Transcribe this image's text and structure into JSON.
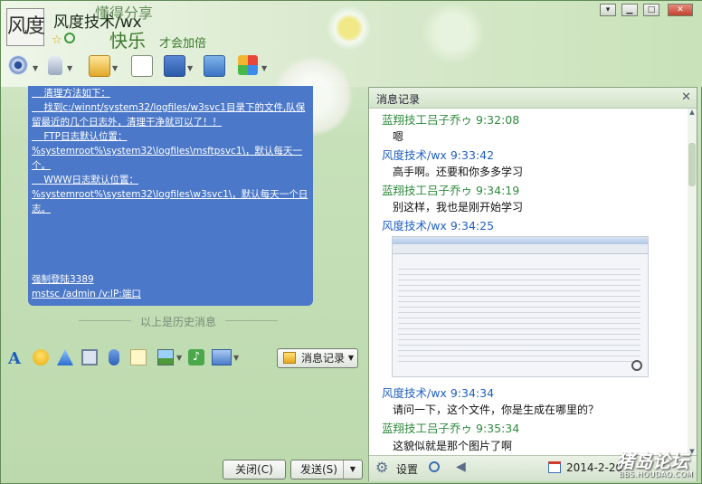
{
  "window": {
    "contact_name": "风度技术/wx",
    "avatar_text": "风度",
    "banner_text_1": "懂得分享",
    "banner_text_2": "快乐",
    "banner_text_3": "才会加倍"
  },
  "chat": {
    "lines": [
      "    清理方法如下：",
      "    找到c:/winnt/system32/logfiles/w3svc1目录下的文件,队保留最近的几个日志外，清理干净就可以了！！",
      "    FTP日志默认位置：%systemroot%\\system32\\logfiles\\msftpsvc1\\，默认每天一个。",
      "    WWW日志默认位置：%systemroot%\\system32\\logfiles\\w3svc1\\，默认每天一个日志。"
    ],
    "link1": "强制登陆3389",
    "link2": "mstsc /admin /v:IP:端口"
  },
  "history_divider": "以上是历史消息",
  "toolbar": {
    "msg_log_label": "消息记录"
  },
  "buttons": {
    "close": "关闭(C)",
    "send": "发送(S)"
  },
  "panel": {
    "title": "消息记录",
    "messages": [
      {
        "sender": "蓝翔技工吕子乔ゥ",
        "time": "9:32:08",
        "text": "嗯",
        "me": false
      },
      {
        "sender": "风度技术/wx",
        "time": "9:33:42",
        "text": "高手啊。还要和你多多学习",
        "me": true
      },
      {
        "sender": "蓝翔技工吕子乔ゥ",
        "time": "9:34:19",
        "text": "别这样，我也是刚开始学习",
        "me": false
      },
      {
        "sender": "风度技术/wx",
        "time": "9:34:25",
        "text": "",
        "me": true
      },
      {
        "sender": "风度技术/wx",
        "time": "9:34:34",
        "text": "请问一下，这个文件，你是生成在哪里的？",
        "me": true
      },
      {
        "sender": "蓝翔技工吕子乔ゥ",
        "time": "9:35:34",
        "text": "这貌似就是那个图片了啊",
        "me": false
      }
    ],
    "settings_label": "设置",
    "date": "2014-2-20"
  },
  "watermark": {
    "title": "猪岛论坛",
    "url": "BBS.HOUDAO.COM"
  },
  "colors": {
    "chat_bg": "#4b78c8",
    "green_name": "#2e8b3c",
    "blue_name": "#1f5fbf"
  }
}
